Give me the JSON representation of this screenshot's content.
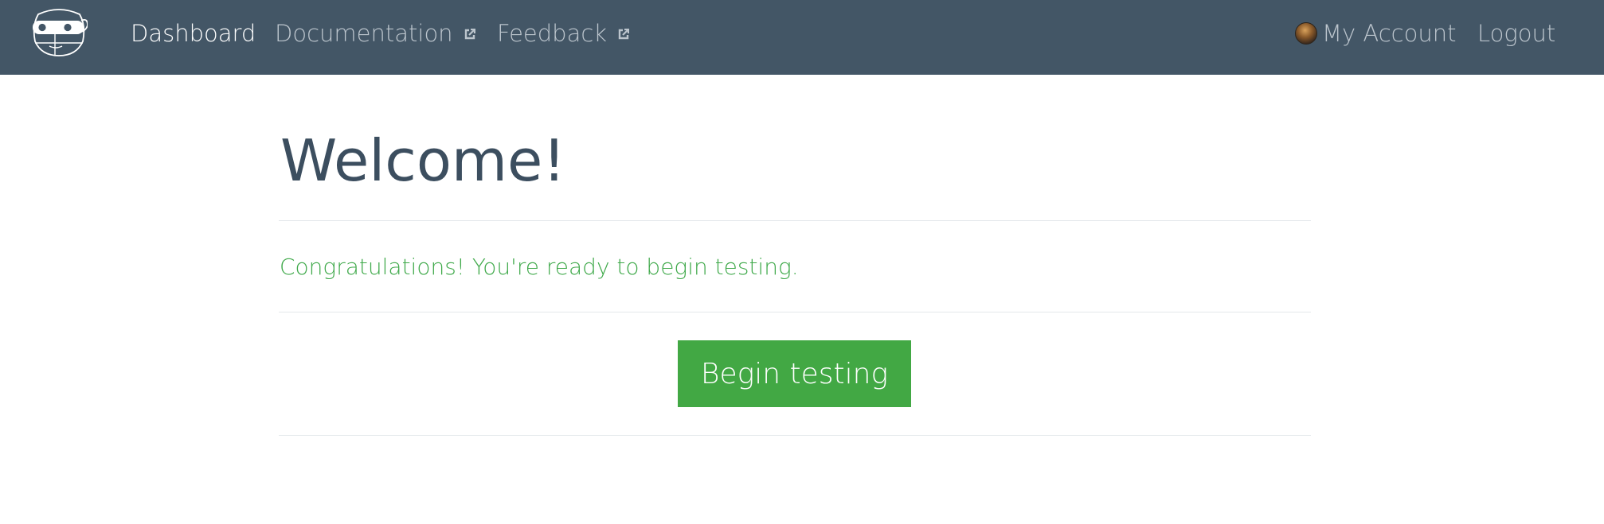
{
  "nav": {
    "logo_icon": "ninja-mascot-icon",
    "items": [
      {
        "label": "Dashboard",
        "active": true
      },
      {
        "label": "Documentation",
        "icon": "external-link-icon"
      },
      {
        "label": "Feedback",
        "icon": "external-link-icon"
      }
    ],
    "account": {
      "label": "My Account",
      "icon": "avatar"
    },
    "logout": {
      "label": "Logout"
    }
  },
  "main": {
    "title": "Welcome!",
    "message": "Congratulations! You're ready to begin testing.",
    "button_label": "Begin testing"
  },
  "colors": {
    "navbar_bg": "#435666",
    "title": "#3c4e5f",
    "success_text": "#3fa94a",
    "button_bg": "#42a844"
  }
}
